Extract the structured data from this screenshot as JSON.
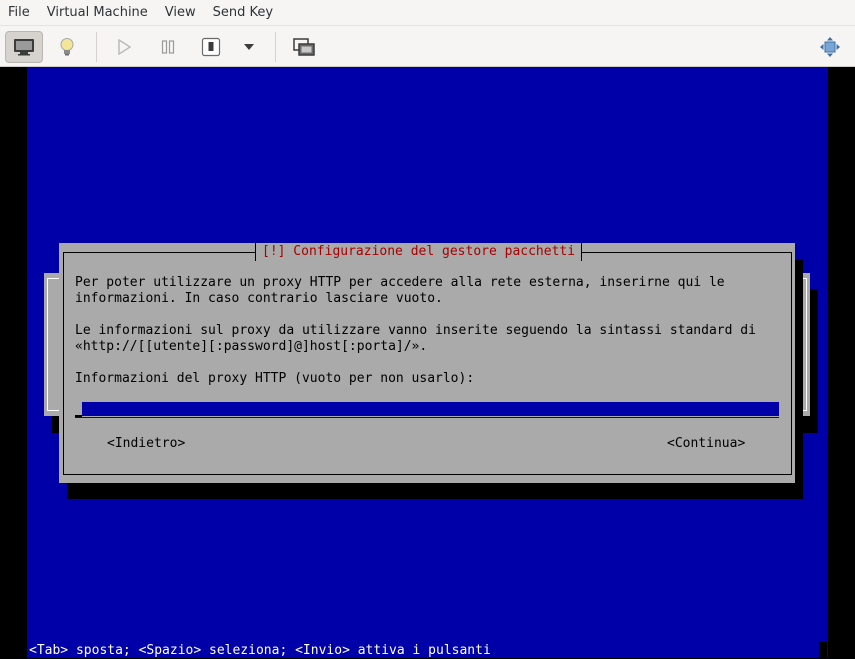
{
  "menubar": {
    "items": [
      "File",
      "Virtual Machine",
      "View",
      "Send Key"
    ]
  },
  "toolbar": {
    "buttons": [
      {
        "name": "console-view",
        "icon": "monitor-icon",
        "active": true
      },
      {
        "name": "details-view",
        "icon": "lightbulb-icon"
      },
      {
        "name": "run",
        "icon": "play-icon"
      },
      {
        "name": "pause",
        "icon": "pause-icon"
      },
      {
        "name": "shutdown",
        "icon": "power-icon"
      },
      {
        "name": "shutdown-menu",
        "icon": "chevron-down-icon"
      },
      {
        "name": "snapshots",
        "icon": "snapshots-icon"
      },
      {
        "name": "fullscreen",
        "icon": "fullscreen-icon"
      }
    ]
  },
  "installer": {
    "dialog_title": "[!] Configurazione del gestore pacchetti",
    "paragraph1_line1": "Per poter utilizzare un proxy HTTP per accedere alla rete esterna, inserirne qui le",
    "paragraph1_line2": "informazioni. In caso contrario lasciare vuoto.",
    "paragraph2_line1": "Le informazioni sul proxy da utilizzare vanno inserite seguendo la sintassi standard di",
    "paragraph2_line2": "«http://[[utente][:password]@]host[:porta]/».",
    "field_label": "Informazioni del proxy HTTP (vuoto per non usarlo):",
    "field_value": "",
    "back_button": "<Indietro>",
    "continue_button": "<Continua>",
    "status_line": "<Tab> sposta; <Spazio> seleziona; <Invio> attiva i pulsanti"
  },
  "colors": {
    "screen_blue": "#0000a8",
    "dialog_gray": "#aaaaaa",
    "title_red": "#a80000"
  }
}
